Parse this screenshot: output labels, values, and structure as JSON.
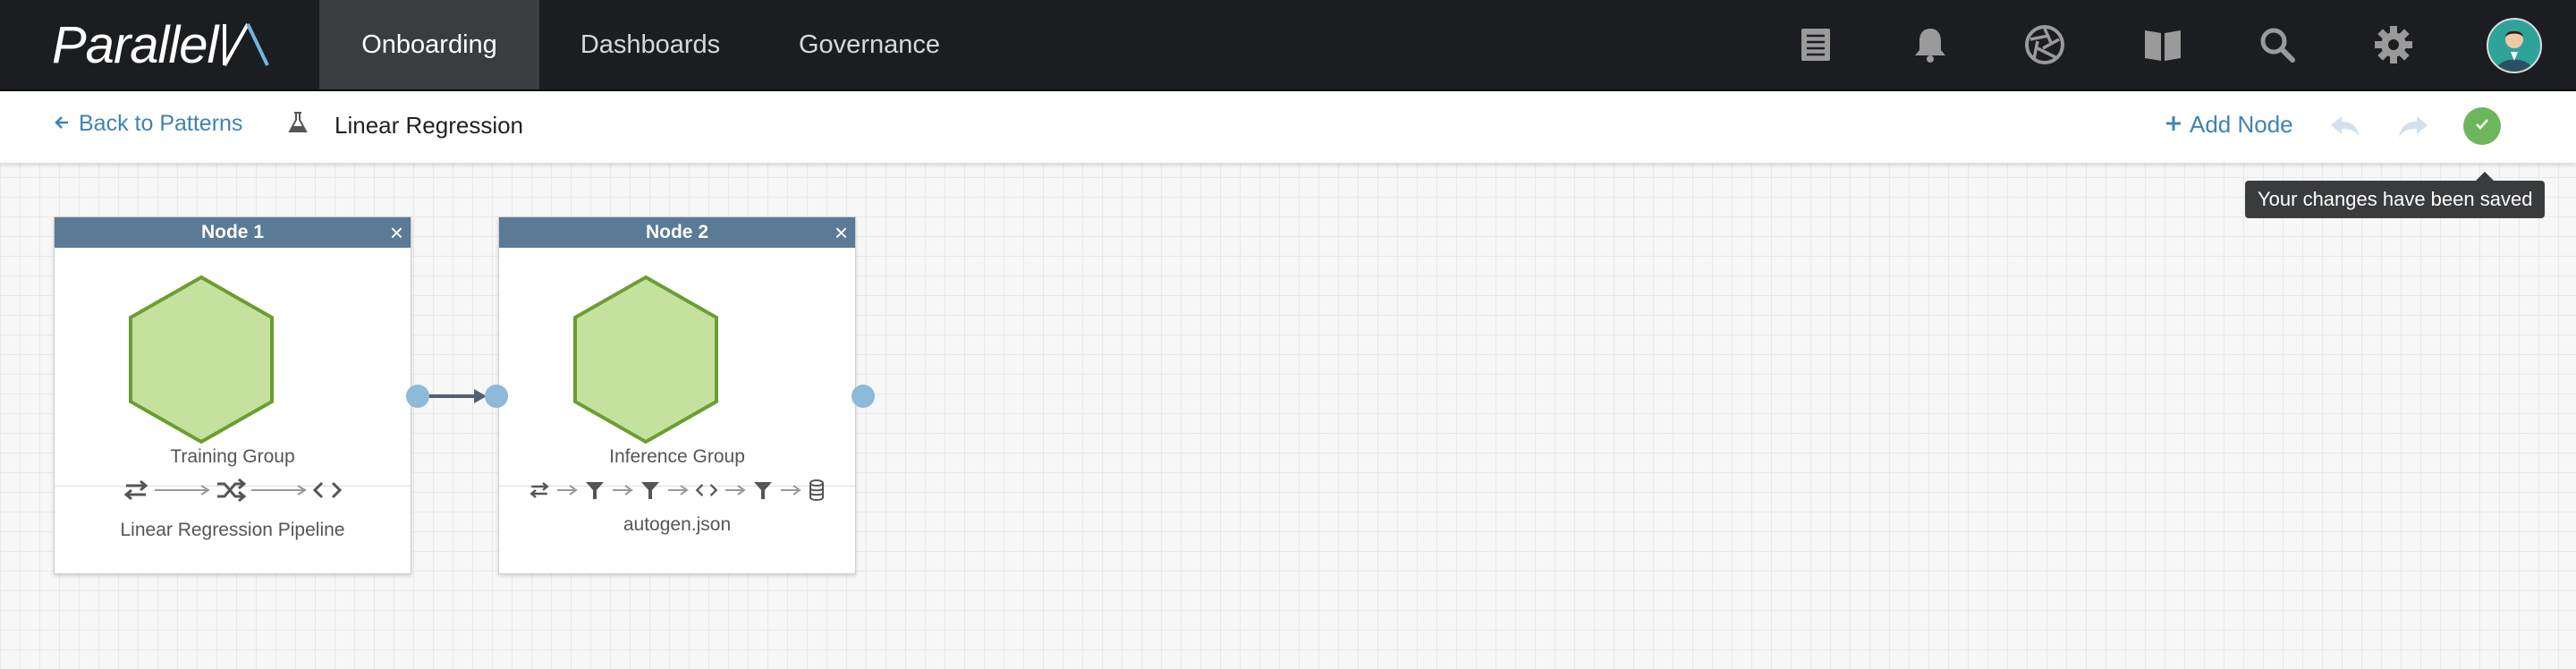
{
  "nav": {
    "logo": "Parallel",
    "tabs": [
      "Onboarding",
      "Dashboards",
      "Governance"
    ],
    "active_tab": "Onboarding",
    "icons": [
      "list-icon",
      "bell-icon",
      "aperture-icon",
      "book-icon",
      "search-icon",
      "gear-icon",
      "avatar"
    ]
  },
  "subheader": {
    "back_label": "Back to Patterns",
    "pattern_title": "Linear Regression",
    "add_node_label": "Add Node",
    "saved_tooltip": "Your changes have been saved"
  },
  "nodes": [
    {
      "title": "Node 1",
      "group": "Training Group",
      "pipeline_label": "Linear Regression Pipeline",
      "steps": [
        "transform-icon",
        "shuffle-icon",
        "code-icon"
      ]
    },
    {
      "title": "Node 2",
      "group": "Inference Group",
      "pipeline_label": "autogen.json",
      "steps": [
        "transform-icon",
        "filter-icon",
        "filter-icon",
        "code-icon",
        "filter-icon",
        "database-icon"
      ]
    }
  ],
  "colors": {
    "nav_bg": "#1b1d20",
    "node_header": "#5a7a96",
    "hex_fill": "#c5e19e",
    "hex_stroke": "#6a9e33",
    "link_blue": "#3f83b3",
    "port": "#8db9da",
    "saved_green": "#6db65b"
  }
}
